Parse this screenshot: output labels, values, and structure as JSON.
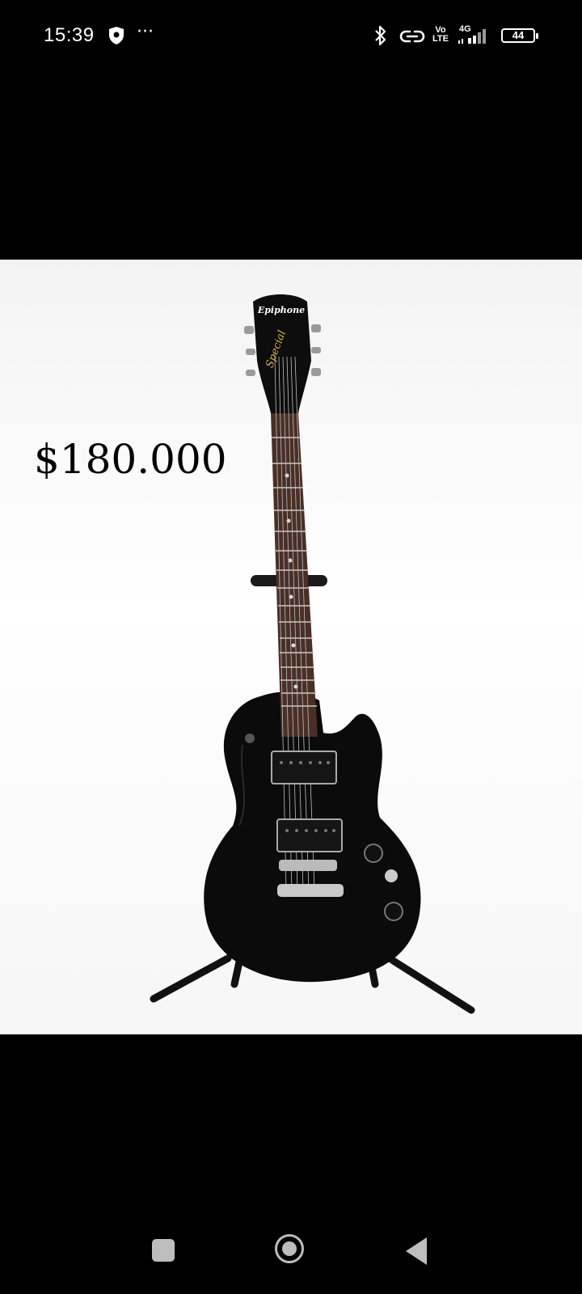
{
  "status_bar": {
    "time": "15:39",
    "icons": [
      "shield-icon",
      "more-dots-icon",
      "bluetooth-icon",
      "link-icon",
      "volte-icon",
      "signal-4g-icon",
      "battery-icon"
    ],
    "more": "···",
    "volte_top": "Vo",
    "volte_bottom": "LTE",
    "network": "4G",
    "battery_level": "44"
  },
  "content": {
    "price": "$180.000",
    "headstock_brand": "Epiphone",
    "headstock_model": "Special"
  },
  "nav_bar": {
    "buttons": [
      "recents-button",
      "home-button",
      "back-button"
    ]
  }
}
